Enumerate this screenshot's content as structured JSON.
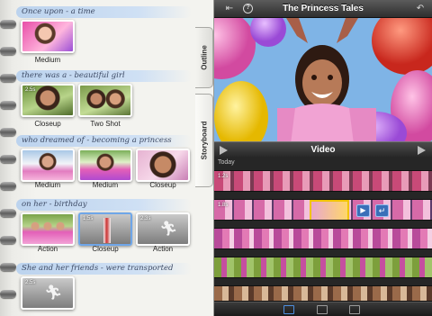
{
  "app": {
    "title": "The Princess Tales"
  },
  "tabs": {
    "outline": "Outline",
    "storyboard": "Storyboard"
  },
  "storyboard": {
    "sections": [
      {
        "caption": "Once upon - a time",
        "shots": [
          {
            "label": "Medium",
            "duration": ""
          }
        ]
      },
      {
        "caption": "there was a - beautiful girl",
        "shots": [
          {
            "label": "Closeup",
            "duration": "2.5s"
          },
          {
            "label": "Two Shot",
            "duration": ""
          }
        ]
      },
      {
        "caption": "who dreamed of - becoming a princess",
        "shots": [
          {
            "label": "Medium",
            "duration": ""
          },
          {
            "label": "Medium",
            "duration": ""
          },
          {
            "label": "Closeup",
            "duration": ""
          }
        ]
      },
      {
        "caption": "on her - birthday",
        "shots": [
          {
            "label": "Action",
            "duration": ""
          },
          {
            "label": "Closeup",
            "duration": "1.5s"
          },
          {
            "label": "Action",
            "duration": "2.3s"
          }
        ]
      },
      {
        "caption": "She and her friends - were transported",
        "shots": [
          {
            "label": "",
            "duration": "2.5s"
          }
        ]
      }
    ]
  },
  "video": {
    "header": "Video",
    "section_label": "Today",
    "strips": [
      {
        "duration": "1.2s"
      },
      {
        "duration": "1.8s"
      },
      {
        "duration": ""
      },
      {
        "duration": ""
      },
      {
        "duration": ""
      }
    ]
  },
  "icons": {
    "import": "import-icon",
    "info": "info-icon",
    "undo": "undo-icon",
    "play_left": "play-icon",
    "play_right": "play-icon",
    "list": "list-icon",
    "stack": "stack-icon",
    "camera": "camera-icon"
  }
}
